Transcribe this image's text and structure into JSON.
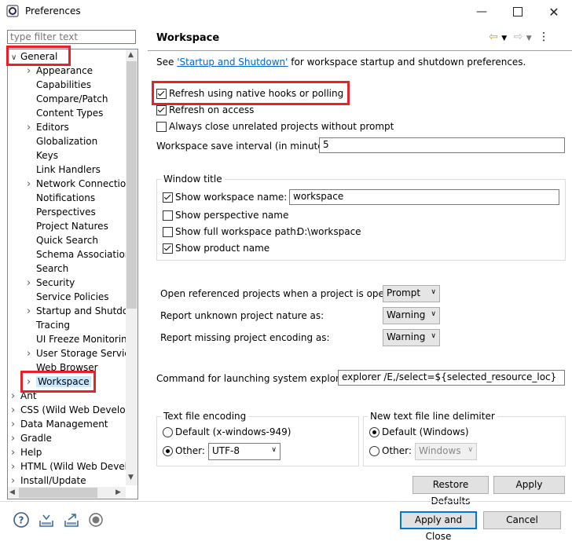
{
  "window": {
    "title": "Preferences"
  },
  "filter": {
    "placeholder": "type filter text"
  },
  "tree": [
    {
      "label": "General",
      "arrow": "v",
      "indent": 0,
      "top": 0
    },
    {
      "label": "Appearance",
      "arrow": ">",
      "indent": 1
    },
    {
      "label": "Capabilities",
      "arrow": "",
      "indent": 1
    },
    {
      "label": "Compare/Patch",
      "arrow": "",
      "indent": 1
    },
    {
      "label": "Content Types",
      "arrow": "",
      "indent": 1
    },
    {
      "label": "Editors",
      "arrow": ">",
      "indent": 1
    },
    {
      "label": "Globalization",
      "arrow": "",
      "indent": 1
    },
    {
      "label": "Keys",
      "arrow": "",
      "indent": 1
    },
    {
      "label": "Link Handlers",
      "arrow": "",
      "indent": 1
    },
    {
      "label": "Network Connection",
      "arrow": ">",
      "indent": 1
    },
    {
      "label": "Notifications",
      "arrow": "",
      "indent": 1
    },
    {
      "label": "Perspectives",
      "arrow": "",
      "indent": 1
    },
    {
      "label": "Project Natures",
      "arrow": "",
      "indent": 1
    },
    {
      "label": "Quick Search",
      "arrow": "",
      "indent": 1
    },
    {
      "label": "Schema Associations",
      "arrow": "",
      "indent": 1
    },
    {
      "label": "Search",
      "arrow": "",
      "indent": 1
    },
    {
      "label": "Security",
      "arrow": ">",
      "indent": 1
    },
    {
      "label": "Service Policies",
      "arrow": "",
      "indent": 1
    },
    {
      "label": "Startup and Shutdown",
      "arrow": ">",
      "indent": 1
    },
    {
      "label": "Tracing",
      "arrow": "",
      "indent": 1
    },
    {
      "label": "UI Freeze Monitoring",
      "arrow": "",
      "indent": 1
    },
    {
      "label": "User Storage Service",
      "arrow": ">",
      "indent": 1
    },
    {
      "label": "Web Browser",
      "arrow": "",
      "indent": 1
    },
    {
      "label": "Workspace",
      "arrow": ">",
      "indent": 1
    },
    {
      "label": "Ant",
      "arrow": ">",
      "indent": 0
    },
    {
      "label": "CSS (Wild Web Developer)",
      "arrow": ">",
      "indent": 0
    },
    {
      "label": "Data Management",
      "arrow": ">",
      "indent": 0
    },
    {
      "label": "Gradle",
      "arrow": ">",
      "indent": 0
    },
    {
      "label": "Help",
      "arrow": ">",
      "indent": 0
    },
    {
      "label": "HTML (Wild Web Developer)",
      "arrow": ">",
      "indent": 0
    },
    {
      "label": "Install/Update",
      "arrow": ">",
      "indent": 0
    }
  ],
  "page": {
    "title": "Workspace",
    "see_prefix": "See ",
    "see_link": "'Startup and Shutdown'",
    "see_suffix": " for workspace startup and shutdown preferences.",
    "refresh_native": "Refresh using native hooks or polling",
    "refresh_access": "Refresh on access",
    "always_close": "Always close unrelated projects without prompt",
    "save_interval_label": "Workspace save interval (in minutes):",
    "save_interval_value": "5",
    "window_title_group": "Window title",
    "show_ws_name": "Show workspace name:",
    "ws_name_value": "workspace",
    "show_perspective": "Show perspective name",
    "show_full_path": "Show full workspace path:",
    "full_path_value": "D:\\workspace",
    "show_product": "Show product name",
    "open_ref_label": "Open referenced projects when a project is opened:",
    "open_ref_value": "Prompt",
    "unknown_nature_label": "Report unknown project nature as:",
    "unknown_nature_value": "Warning",
    "missing_enc_label": "Report missing project encoding as:",
    "missing_enc_value": "Warning",
    "explorer_label": "Command for launching system explorer:",
    "explorer_value": "explorer /E,/select=${selected_resource_loc}",
    "text_enc_group": "Text file encoding",
    "enc_default": "Default (x-windows-949)",
    "enc_other": "Other:",
    "enc_other_value": "UTF-8",
    "line_delim_group": "New text file line delimiter",
    "delim_default": "Default (Windows)",
    "delim_other": "Other:",
    "delim_other_value": "Windows"
  },
  "buttons": {
    "restore_defaults": "Restore Defaults",
    "apply": "Apply",
    "apply_close": "Apply and Close",
    "cancel": "Cancel"
  },
  "colors": {
    "highlight": "#e8202a",
    "link": "#0066cc"
  }
}
